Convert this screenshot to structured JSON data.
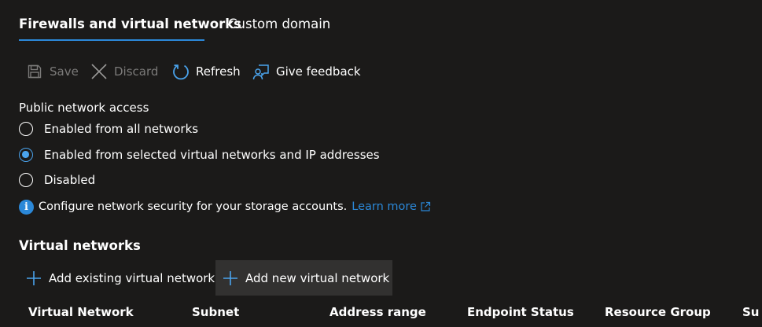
{
  "tabs": [
    {
      "label": "Firewalls and virtual networks",
      "active": true
    },
    {
      "label": "Custom domain",
      "active": false
    }
  ],
  "toolbar": {
    "save_label": "Save",
    "discard_label": "Discard",
    "refresh_label": "Refresh",
    "feedback_label": "Give feedback"
  },
  "public_access": {
    "label": "Public network access",
    "options": [
      {
        "label": "Enabled from all networks",
        "selected": false
      },
      {
        "label": "Enabled from selected virtual networks and IP addresses",
        "selected": true
      },
      {
        "label": "Disabled",
        "selected": false
      }
    ]
  },
  "info": {
    "text": "Configure network security for your storage accounts.",
    "link": "Learn more"
  },
  "virtual_networks": {
    "heading": "Virtual networks",
    "add_existing": "Add existing virtual network",
    "add_new": "Add new virtual network",
    "columns": [
      "Virtual Network",
      "Subnet",
      "Address range",
      "Endpoint Status",
      "Resource Group",
      "Su"
    ]
  },
  "colors": {
    "background": "#1b1a19",
    "accent": "#2b88d8",
    "radio_checked": "#4aa3ec",
    "disabled_text": "#7b7a79",
    "hover_bg": "#323130"
  },
  "icons": {
    "save": "save-icon",
    "discard": "close-icon",
    "refresh": "refresh-icon",
    "feedback": "feedback-icon",
    "info": "info-icon",
    "external": "external-link-icon",
    "add": "plus-icon"
  }
}
